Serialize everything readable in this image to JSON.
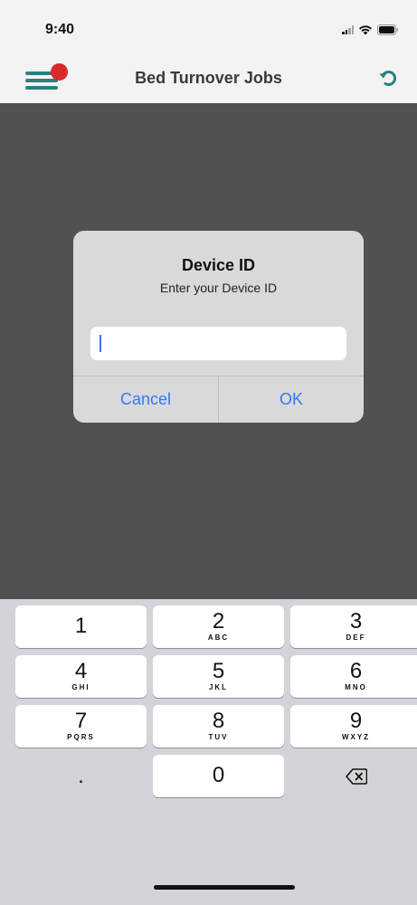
{
  "status_bar": {
    "time": "9:40"
  },
  "nav": {
    "title": "Bed Turnover Jobs",
    "accent_color": "#2b7f7f",
    "badge_color": "#d92a2a"
  },
  "dialog": {
    "title": "Device ID",
    "message": "Enter your Device ID",
    "input_value": "",
    "cancel_label": "Cancel",
    "ok_label": "OK",
    "button_color": "#3478f6"
  },
  "keypad": {
    "keys": [
      {
        "digit": "1",
        "letters": ""
      },
      {
        "digit": "2",
        "letters": "ABC"
      },
      {
        "digit": "3",
        "letters": "DEF"
      },
      {
        "digit": "4",
        "letters": "GHI"
      },
      {
        "digit": "5",
        "letters": "JKL"
      },
      {
        "digit": "6",
        "letters": "MNO"
      },
      {
        "digit": "7",
        "letters": "PQRS"
      },
      {
        "digit": "8",
        "letters": "TUV"
      },
      {
        "digit": "9",
        "letters": "WXYZ"
      },
      {
        "digit": "0",
        "letters": ""
      }
    ],
    "decimal_label": ".",
    "delete_icon": "backspace-icon"
  }
}
